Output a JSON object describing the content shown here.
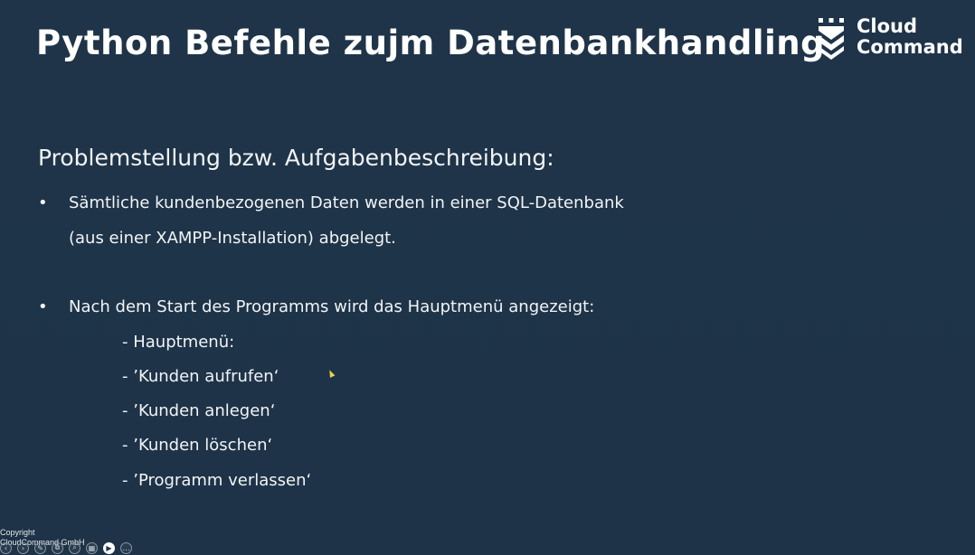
{
  "slide": {
    "title": "Python Befehle zujm Datenbankhandling",
    "logo": {
      "line1": "Cloud",
      "line2": "Command"
    },
    "subheading": "Problemstellung bzw. Aufgabenbeschreibung:",
    "bullets": [
      {
        "marker": "•",
        "lines": [
          "Sämtliche kundenbezogenen Daten werden in einer SQL-Datenbank",
          "(aus einer XAMPP-Installation) abgelegt."
        ]
      },
      {
        "marker": "•",
        "lines": [
          "Nach dem Start des Programms wird das Hauptmenü angezeigt:"
        ]
      }
    ],
    "menu_items": [
      "- Hauptmenü:",
      "- ’Kunden aufrufen‘",
      "- ’Kunden anlegen‘",
      "- ’Kunden löschen‘",
      "- ’Programm verlassen‘"
    ]
  },
  "footer": {
    "copyright_line1": "Copyright",
    "copyright_line2": "CloudCommand GmbH"
  },
  "toolbar": {
    "icons": [
      "previous-icon",
      "next-icon",
      "pen-icon",
      "copy-icon",
      "magnify-icon",
      "slides-grid-icon",
      "camera-icon",
      "more-icon"
    ],
    "glyphs": [
      "‹",
      "›",
      "✎",
      "⧉",
      "⌕",
      "▦",
      "▶",
      "…"
    ]
  },
  "colors": {
    "background": "#1f3448",
    "text": "#f2f4f6",
    "cursor": "#e9d44a"
  }
}
